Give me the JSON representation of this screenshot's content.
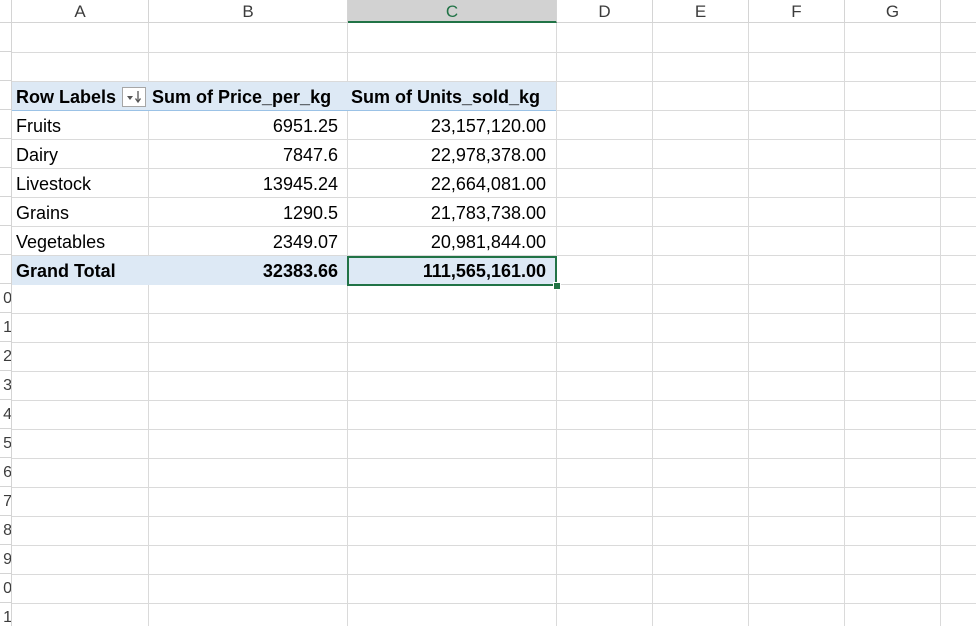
{
  "columns": [
    "A",
    "B",
    "C",
    "D",
    "E",
    "F",
    "G"
  ],
  "selected_column": "C",
  "row_numbers": [
    "0",
    "1",
    "2",
    "3",
    "4",
    "5",
    "6",
    "7",
    "8",
    "9",
    "0",
    "1"
  ],
  "pivot": {
    "headers": {
      "row_labels": "Row Labels",
      "price": "Sum of Price_per_kg",
      "units": "Sum of Units_sold_kg"
    },
    "filter_icon": "sort-descending-filter-icon",
    "rows": [
      {
        "label": "Fruits",
        "price": "6951.25",
        "units": "23,157,120.00"
      },
      {
        "label": "Dairy",
        "price": "7847.6",
        "units": "22,978,378.00"
      },
      {
        "label": "Livestock",
        "price": "13945.24",
        "units": "22,664,081.00"
      },
      {
        "label": "Grains",
        "price": "1290.5",
        "units": "21,783,738.00"
      },
      {
        "label": "Vegetables",
        "price": "2349.07",
        "units": "20,981,844.00"
      }
    ],
    "total": {
      "label": "Grand Total",
      "price": "32383.66",
      "units": "111,565,161.00"
    }
  },
  "colors": {
    "pivot_fill": "#dde9f5",
    "pivot_border": "#9bc2e6",
    "selection": "#217346",
    "gridline": "#dadada"
  }
}
